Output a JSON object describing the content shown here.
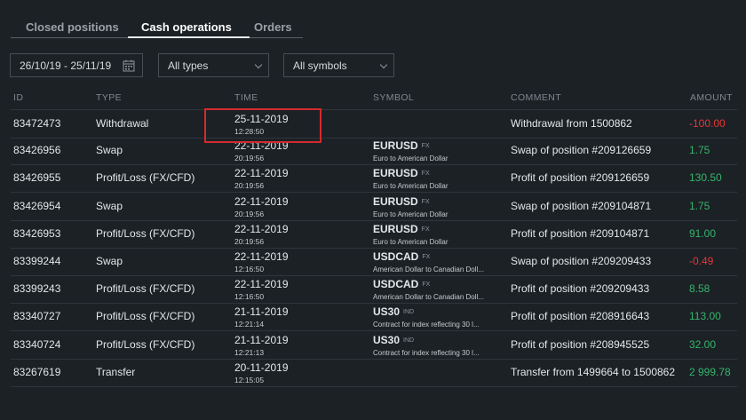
{
  "tabs": [
    {
      "label": "Closed positions"
    },
    {
      "label": "Cash operations"
    },
    {
      "label": "Orders"
    }
  ],
  "filters": {
    "date_range": "26/10/19 - 25/11/19",
    "type": "All types",
    "symbol": "All symbols"
  },
  "columns": {
    "id": "ID",
    "type": "TYPE",
    "time": "TIME",
    "symbol": "SYMBOL",
    "comment": "COMMENT",
    "amount": "AMOUNT"
  },
  "rows": [
    {
      "id": "83472473",
      "type": "Withdrawal",
      "date": "25-11-2019",
      "time": "12:28:50",
      "symbol": "",
      "symbol_tag": "",
      "symbol_desc": "",
      "comment": "Withdrawal from 1500862",
      "amount": "-100.00",
      "sign": "neg"
    },
    {
      "id": "83426956",
      "type": "Swap",
      "date": "22-11-2019",
      "time": "20:19:56",
      "symbol": "EURUSD",
      "symbol_tag": "FX",
      "symbol_desc": "Euro to American Dollar",
      "comment": "Swap of position #209126659",
      "amount": "1.75",
      "sign": "pos"
    },
    {
      "id": "83426955",
      "type": "Profit/Loss (FX/CFD)",
      "date": "22-11-2019",
      "time": "20:19:56",
      "symbol": "EURUSD",
      "symbol_tag": "FX",
      "symbol_desc": "Euro to American Dollar",
      "comment": "Profit of position #209126659",
      "amount": "130.50",
      "sign": "pos"
    },
    {
      "id": "83426954",
      "type": "Swap",
      "date": "22-11-2019",
      "time": "20:19:56",
      "symbol": "EURUSD",
      "symbol_tag": "FX",
      "symbol_desc": "Euro to American Dollar",
      "comment": "Swap of position #209104871",
      "amount": "1.75",
      "sign": "pos"
    },
    {
      "id": "83426953",
      "type": "Profit/Loss (FX/CFD)",
      "date": "22-11-2019",
      "time": "20:19:56",
      "symbol": "EURUSD",
      "symbol_tag": "FX",
      "symbol_desc": "Euro to American Dollar",
      "comment": "Profit of position #209104871",
      "amount": "91.00",
      "sign": "pos"
    },
    {
      "id": "83399244",
      "type": "Swap",
      "date": "22-11-2019",
      "time": "12:16:50",
      "symbol": "USDCAD",
      "symbol_tag": "FX",
      "symbol_desc": "American Dollar to Canadian Doll...",
      "comment": "Swap of position #209209433",
      "amount": "-0.49",
      "sign": "neg"
    },
    {
      "id": "83399243",
      "type": "Profit/Loss (FX/CFD)",
      "date": "22-11-2019",
      "time": "12:16:50",
      "symbol": "USDCAD",
      "symbol_tag": "FX",
      "symbol_desc": "American Dollar to Canadian Doll...",
      "comment": "Profit of position #209209433",
      "amount": "8.58",
      "sign": "pos"
    },
    {
      "id": "83340727",
      "type": "Profit/Loss (FX/CFD)",
      "date": "21-11-2019",
      "time": "12:21:14",
      "symbol": "US30",
      "symbol_tag": "IND",
      "symbol_desc": "Contract for index reflecting 30 l...",
      "comment": "Profit of position #208916643",
      "amount": "113.00",
      "sign": "pos"
    },
    {
      "id": "83340724",
      "type": "Profit/Loss (FX/CFD)",
      "date": "21-11-2019",
      "time": "12:21:13",
      "symbol": "US30",
      "symbol_tag": "IND",
      "symbol_desc": "Contract for index reflecting 30 l...",
      "comment": "Profit of position #208945525",
      "amount": "32.00",
      "sign": "pos"
    },
    {
      "id": "83267619",
      "type": "Transfer",
      "date": "20-11-2019",
      "time": "12:15:05",
      "symbol": "",
      "symbol_tag": "",
      "symbol_desc": "",
      "comment": "Transfer from 1499664 to 1500862",
      "amount": "2 999.78",
      "sign": "pos"
    }
  ],
  "colors": {
    "negative": "#e53935",
    "positive": "#34b56a",
    "highlight_box": "#d42a2a"
  },
  "icons": {
    "date_picker": "calendar-icon",
    "dropdown": "chevron-down-icon"
  }
}
